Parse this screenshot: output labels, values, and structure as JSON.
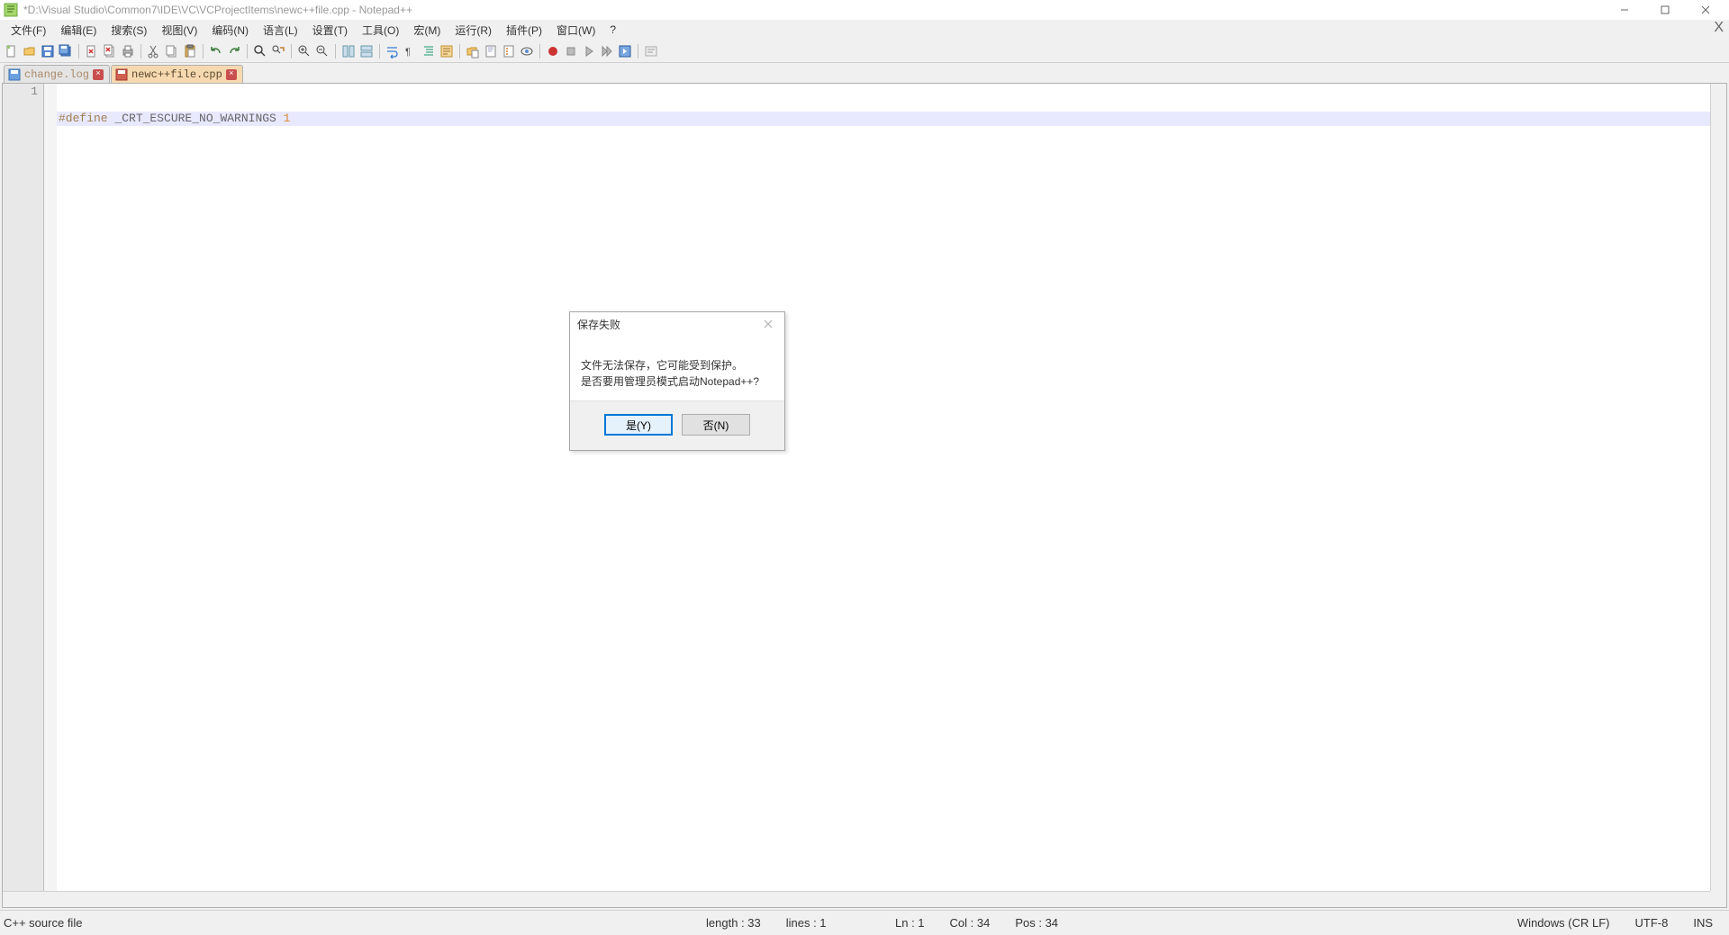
{
  "window": {
    "title": "*D:\\Visual Studio\\Common7\\IDE\\VC\\VCProjectItems\\newc++file.cpp - Notepad++"
  },
  "menu": {
    "items": [
      "文件(F)",
      "编辑(E)",
      "搜索(S)",
      "视图(V)",
      "编码(N)",
      "语言(L)",
      "设置(T)",
      "工具(O)",
      "宏(M)",
      "运行(R)",
      "插件(P)",
      "窗口(W)",
      "?"
    ]
  },
  "toolbar": {
    "icons": [
      "new-file-icon",
      "open-file-icon",
      "save-icon",
      "save-all-icon",
      "sep",
      "close-icon",
      "close-all-icon",
      "print-icon",
      "sep",
      "cut-icon",
      "copy-icon",
      "paste-icon",
      "sep",
      "undo-icon",
      "redo-icon",
      "sep",
      "find-icon",
      "replace-icon",
      "sep",
      "zoom-in-icon",
      "zoom-out-icon",
      "sep",
      "sync-v-icon",
      "sync-h-icon",
      "sep",
      "word-wrap-icon",
      "show-all-icon",
      "indent-icon",
      "outdent-icon",
      "sep",
      "folder-doc-icon",
      "doc-map-icon",
      "func-list-icon",
      "monitor-icon",
      "sep",
      "record-icon",
      "stop-icon",
      "play-icon",
      "play-multi-icon",
      "save-macro-icon",
      "sep",
      "spellcheck-icon"
    ]
  },
  "tabs": [
    {
      "label": "change.log",
      "dirty": true
    },
    {
      "label": "newc++file.cpp",
      "dirty": true
    }
  ],
  "activeTab": 1,
  "editor": {
    "lineNumber": "1",
    "tokens": {
      "def": "#define",
      "ident": "_CRT_ESCURE_NO_WARNINGS",
      "num": "1"
    }
  },
  "status": {
    "filetype": "C++ source file",
    "length": "length : 33",
    "lines": "lines : 1",
    "ln": "Ln : 1",
    "col": "Col : 34",
    "pos": "Pos : 34",
    "eol": "Windows (CR LF)",
    "encoding": "UTF-8",
    "ins": "INS"
  },
  "dialog": {
    "title": "保存失败",
    "line1": "文件无法保存，它可能受到保护。",
    "line2": "是否要用管理员模式启动Notepad++?",
    "yes": "是(Y)",
    "no": "否(N)"
  }
}
